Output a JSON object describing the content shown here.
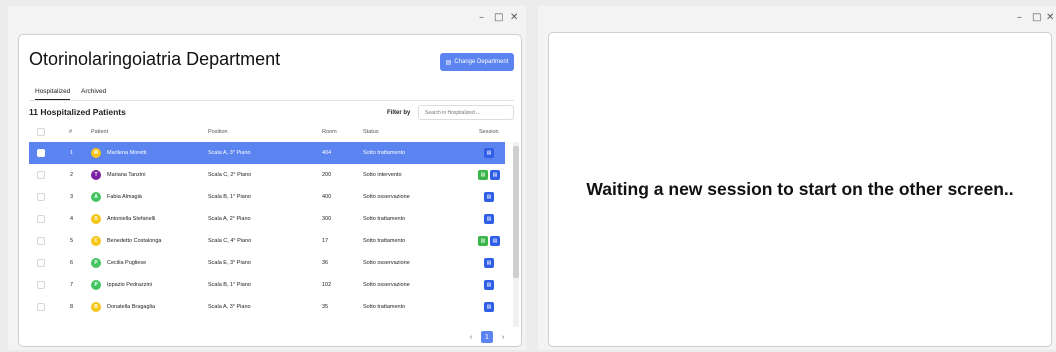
{
  "left_window": {
    "controls": {
      "minimize": "–",
      "maximize": "□",
      "close": "✕"
    },
    "title": "Otorinolaringoiatria Department",
    "change_button": "Change Department",
    "tabs": [
      {
        "label": "Hospitalized",
        "active": true
      },
      {
        "label": "Archived",
        "active": false
      }
    ],
    "count_label": "11 Hospitalized Patients",
    "filter_label": "Filter by",
    "search_placeholder": "Search in Hospitalized ...",
    "headers": {
      "num": "#",
      "patient": "Patient",
      "position": "Position",
      "room": "Room",
      "status": "Status",
      "session": "Session"
    },
    "rows": [
      {
        "num": "1",
        "initial": "M",
        "avatar_color": "#f5c518",
        "patient": "Marilena Moretti",
        "position": "Scala A, 3° Piano",
        "room": "404",
        "status": "Sotto trattamento",
        "sessions": [
          "blue"
        ],
        "selected": true
      },
      {
        "num": "2",
        "initial": "T",
        "avatar_color": "#7b1fa2",
        "patient": "Mariana Tanzini",
        "position": "Scala C, 2° Piano",
        "room": "200",
        "status": "Sotto intervento",
        "sessions": [
          "green",
          "blue"
        ],
        "selected": false
      },
      {
        "num": "3",
        "initial": "A",
        "avatar_color": "#43c463",
        "patient": "Fabia Almagià",
        "position": "Scala B, 1° Piano",
        "room": "400",
        "status": "Sotto osservazione",
        "sessions": [
          "blue"
        ],
        "selected": false
      },
      {
        "num": "4",
        "initial": "S",
        "avatar_color": "#f5c518",
        "patient": "Antoniella Stefanelli",
        "position": "Scala A, 2° Piano",
        "room": "300",
        "status": "Sotto trattamento",
        "sessions": [
          "blue"
        ],
        "selected": false
      },
      {
        "num": "5",
        "initial": "C",
        "avatar_color": "#f5c518",
        "patient": "Benedetto Costalonga",
        "position": "Scala C, 4° Piano",
        "room": "17",
        "status": "Sotto trattamento",
        "sessions": [
          "green",
          "blue"
        ],
        "selected": false
      },
      {
        "num": "6",
        "initial": "P",
        "avatar_color": "#43c463",
        "patient": "Cecilia Pugliese",
        "position": "Scala E, 3° Piano",
        "room": "36",
        "status": "Sotto osservazione",
        "sessions": [
          "blue"
        ],
        "selected": false
      },
      {
        "num": "7",
        "initial": "P",
        "avatar_color": "#43c463",
        "patient": "Ippazio Pedrazzini",
        "position": "Scala B, 1° Piano",
        "room": "102",
        "status": "Sotto osservazione",
        "sessions": [
          "blue"
        ],
        "selected": false
      },
      {
        "num": "8",
        "initial": "B",
        "avatar_color": "#f5c518",
        "patient": "Donatella Bragaglia",
        "position": "Scala A, 3° Piano",
        "room": "35",
        "status": "Sotto trattamento",
        "sessions": [
          "blue"
        ],
        "selected": false
      }
    ],
    "pagination": {
      "prev": "‹",
      "current": "1",
      "next": "›"
    }
  },
  "right_window": {
    "controls": {
      "minimize": "–",
      "maximize": "□",
      "close": "✕"
    },
    "message": "Waiting a new session to start on the other screen.."
  },
  "colors": {
    "accent": "#5b84f0",
    "session_blue": "#2f5fe8",
    "session_green": "#3bb54a"
  },
  "icons": {
    "change_button": "building-icon",
    "session": "document-icon",
    "prev": "chevron-left-icon",
    "next": "chevron-right-icon"
  }
}
